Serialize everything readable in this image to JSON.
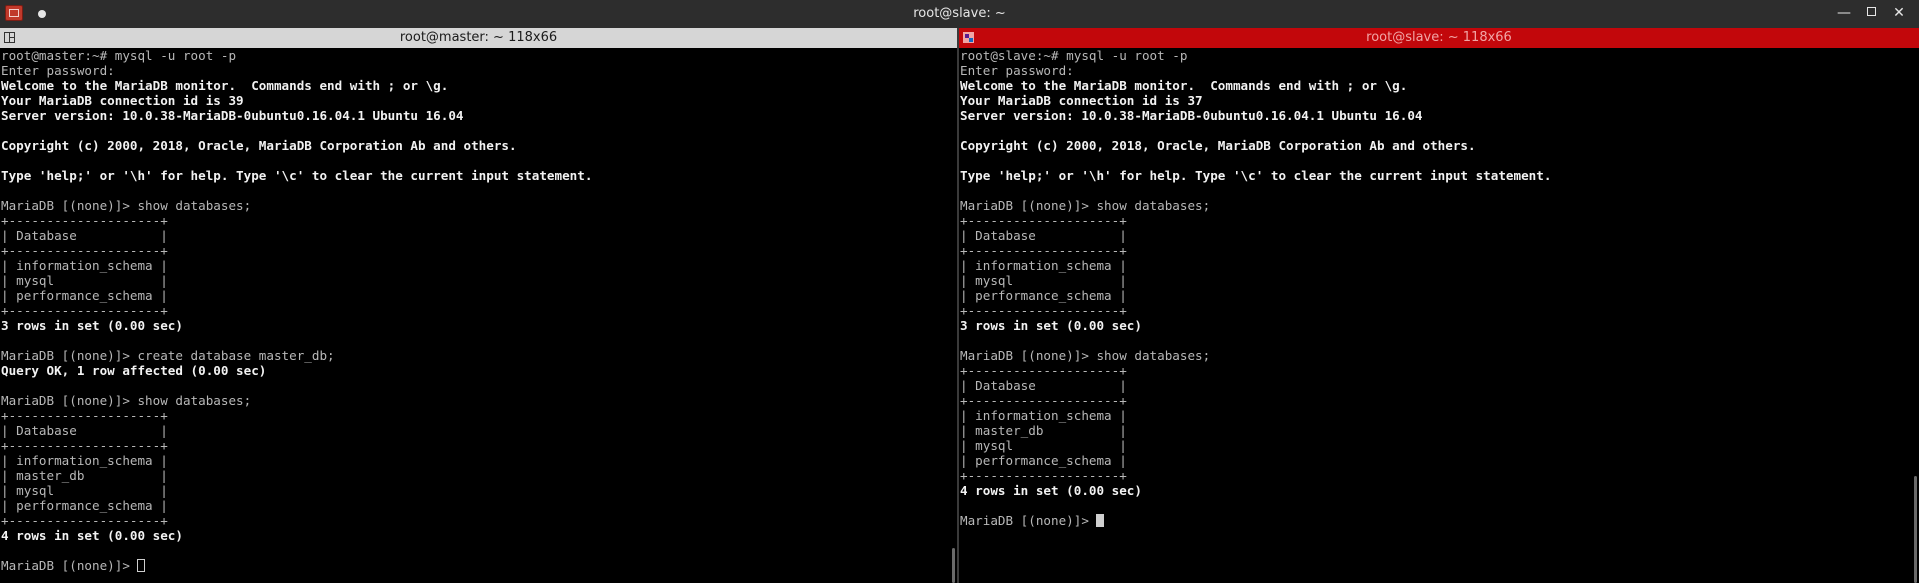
{
  "window": {
    "title": "root@slave: ~",
    "controls": {
      "minimize": "—",
      "maximize": "",
      "close": "✕"
    }
  },
  "left_pane": {
    "header": "root@master: ~ 118x66",
    "lines": [
      {
        "text": "root@master:~# mysql -u root -p",
        "style": "norm"
      },
      {
        "text": "Enter password:",
        "style": "norm"
      },
      {
        "text": "Welcome to the MariaDB monitor.  Commands end with ; or \\g.",
        "style": "bold"
      },
      {
        "text": "Your MariaDB connection id is 39",
        "style": "bold"
      },
      {
        "text": "Server version: 10.0.38-MariaDB-0ubuntu0.16.04.1 Ubuntu 16.04",
        "style": "bold"
      },
      {
        "text": "",
        "style": "norm"
      },
      {
        "text": "Copyright (c) 2000, 2018, Oracle, MariaDB Corporation Ab and others.",
        "style": "bold"
      },
      {
        "text": "",
        "style": "norm"
      },
      {
        "text": "Type 'help;' or '\\h' for help. Type '\\c' to clear the current input statement.",
        "style": "bold"
      },
      {
        "text": "",
        "style": "norm"
      },
      {
        "text": "MariaDB [(none)]> show databases;",
        "style": "norm"
      },
      {
        "text": "+--------------------+",
        "style": "norm"
      },
      {
        "text": "| Database           |",
        "style": "norm"
      },
      {
        "text": "+--------------------+",
        "style": "norm"
      },
      {
        "text": "| information_schema |",
        "style": "norm"
      },
      {
        "text": "| mysql              |",
        "style": "norm"
      },
      {
        "text": "| performance_schema |",
        "style": "norm"
      },
      {
        "text": "+--------------------+",
        "style": "norm"
      },
      {
        "text": "3 rows in set (0.00 sec)",
        "style": "bold"
      },
      {
        "text": "",
        "style": "norm"
      },
      {
        "text": "MariaDB [(none)]> create database master_db;",
        "style": "norm"
      },
      {
        "text": "Query OK, 1 row affected (0.00 sec)",
        "style": "bold"
      },
      {
        "text": "",
        "style": "norm"
      },
      {
        "text": "MariaDB [(none)]> show databases;",
        "style": "norm"
      },
      {
        "text": "+--------------------+",
        "style": "norm"
      },
      {
        "text": "| Database           |",
        "style": "norm"
      },
      {
        "text": "+--------------------+",
        "style": "norm"
      },
      {
        "text": "| information_schema |",
        "style": "norm"
      },
      {
        "text": "| master_db          |",
        "style": "norm"
      },
      {
        "text": "| mysql              |",
        "style": "norm"
      },
      {
        "text": "| performance_schema |",
        "style": "norm"
      },
      {
        "text": "+--------------------+",
        "style": "norm"
      },
      {
        "text": "4 rows in set (0.00 sec)",
        "style": "bold"
      },
      {
        "text": "",
        "style": "norm"
      },
      {
        "text": "MariaDB [(none)]> ",
        "style": "norm",
        "cursor": "hollow"
      }
    ]
  },
  "right_pane": {
    "header": "root@slave: ~ 118x66",
    "lines": [
      {
        "text": "root@slave:~# mysql -u root -p",
        "style": "norm"
      },
      {
        "text": "Enter password:",
        "style": "norm"
      },
      {
        "text": "Welcome to the MariaDB monitor.  Commands end with ; or \\g.",
        "style": "bold"
      },
      {
        "text": "Your MariaDB connection id is 37",
        "style": "bold"
      },
      {
        "text": "Server version: 10.0.38-MariaDB-0ubuntu0.16.04.1 Ubuntu 16.04",
        "style": "bold"
      },
      {
        "text": "",
        "style": "norm"
      },
      {
        "text": "Copyright (c) 2000, 2018, Oracle, MariaDB Corporation Ab and others.",
        "style": "bold"
      },
      {
        "text": "",
        "style": "norm"
      },
      {
        "text": "Type 'help;' or '\\h' for help. Type '\\c' to clear the current input statement.",
        "style": "bold"
      },
      {
        "text": "",
        "style": "norm"
      },
      {
        "text": "MariaDB [(none)]> show databases;",
        "style": "norm"
      },
      {
        "text": "+--------------------+",
        "style": "norm"
      },
      {
        "text": "| Database           |",
        "style": "norm"
      },
      {
        "text": "+--------------------+",
        "style": "norm"
      },
      {
        "text": "| information_schema |",
        "style": "norm"
      },
      {
        "text": "| mysql              |",
        "style": "norm"
      },
      {
        "text": "| performance_schema |",
        "style": "norm"
      },
      {
        "text": "+--------------------+",
        "style": "norm"
      },
      {
        "text": "3 rows in set (0.00 sec)",
        "style": "bold"
      },
      {
        "text": "",
        "style": "norm"
      },
      {
        "text": "MariaDB [(none)]> show databases;",
        "style": "norm"
      },
      {
        "text": "+--------------------+",
        "style": "norm"
      },
      {
        "text": "| Database           |",
        "style": "norm"
      },
      {
        "text": "+--------------------+",
        "style": "norm"
      },
      {
        "text": "| information_schema |",
        "style": "norm"
      },
      {
        "text": "| master_db          |",
        "style": "norm"
      },
      {
        "text": "| mysql              |",
        "style": "norm"
      },
      {
        "text": "| performance_schema |",
        "style": "norm"
      },
      {
        "text": "+--------------------+",
        "style": "norm"
      },
      {
        "text": "4 rows in set (0.00 sec)",
        "style": "bold"
      },
      {
        "text": "",
        "style": "norm"
      },
      {
        "text": "MariaDB [(none)]> ",
        "style": "norm",
        "cursor": "solid"
      }
    ]
  }
}
